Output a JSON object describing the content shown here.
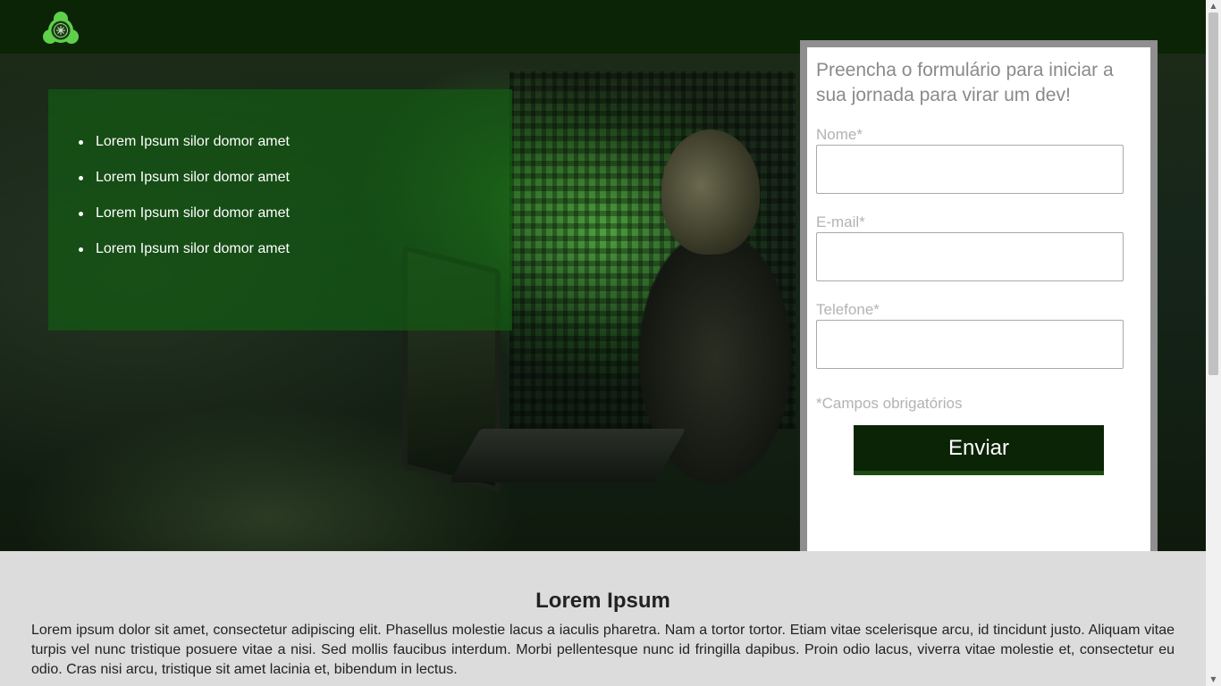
{
  "header": {
    "logo_icon": "tech-logo-icon"
  },
  "hero": {
    "image": "hacker-at-laptop-illustration",
    "list_items": [
      "Lorem Ipsum silor domor amet",
      "Lorem Ipsum silor domor amet",
      "Lorem Ipsum silor domor amet",
      "Lorem Ipsum silor domor amet"
    ]
  },
  "form": {
    "title": "Preencha o formulário para iniciar a sua jornada para virar um dev!",
    "fields": {
      "name": {
        "label": "Nome*",
        "value": ""
      },
      "email": {
        "label": "E-mail*",
        "value": ""
      },
      "phone": {
        "label": "Telefone*",
        "value": ""
      }
    },
    "required_note": "*Campos obrigatórios",
    "submit_label": "Enviar"
  },
  "content": {
    "title": "Lorem Ipsum",
    "paragraph": "Lorem ipsum dolor sit amet, consectetur adipiscing elit. Phasellus molestie lacus a iaculis pharetra. Nam a tortor tortor. Etiam vitae scelerisque arcu, id tincidunt justo. Aliquam vitae turpis vel nunc tristique posuere vitae a nisi. Sed mollis faucibus interdum. Morbi pellentesque nunc id fringilla dapibus. Proin odio lacus, viverra vitae molestie et, consectetur eu odio. Cras nisi arcu, tristique sit amet lacinia et, bibendum in lectus."
  },
  "colors": {
    "header_bg": "#0b2406",
    "panel_green": "#145a14",
    "button_bg": "#0b2406",
    "content_bg": "#dcdcdc"
  }
}
